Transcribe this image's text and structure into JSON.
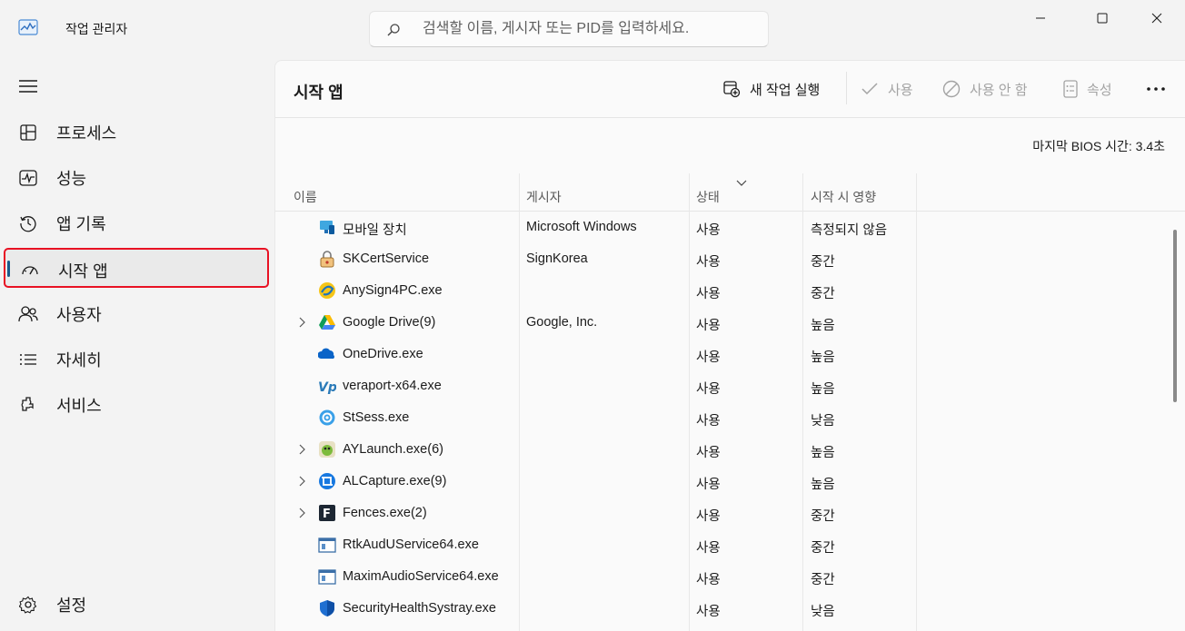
{
  "window": {
    "title": "작업 관리자",
    "search_placeholder": "검색할 이름, 게시자 또는 PID를 입력하세요."
  },
  "sidebar": {
    "items": [
      {
        "label": "프로세스",
        "icon": "processes-icon"
      },
      {
        "label": "성능",
        "icon": "performance-icon"
      },
      {
        "label": "앱 기록",
        "icon": "app-history-icon"
      },
      {
        "label": "시작 앱",
        "icon": "startup-apps-icon",
        "active": true
      },
      {
        "label": "사용자",
        "icon": "users-icon"
      },
      {
        "label": "자세히",
        "icon": "details-icon"
      },
      {
        "label": "서비스",
        "icon": "services-icon"
      }
    ],
    "settings_label": "설정"
  },
  "page": {
    "title": "시작 앱",
    "toolbar": {
      "new_task": "새 작업 실행",
      "enable": "사용",
      "disable": "사용 안 함",
      "properties": "속성"
    },
    "bios_label": "마지막 BIOS 시간:",
    "bios_value": "3.4초"
  },
  "table": {
    "columns": [
      "이름",
      "게시자",
      "상태",
      "시작 시 영향"
    ],
    "rows": [
      {
        "name": "모바일 장치",
        "publisher": "Microsoft Windows",
        "status": "사용",
        "impact": "측정되지 않음",
        "expandable": false,
        "icon": "mobile-devices-icon"
      },
      {
        "name": "SKCertService",
        "publisher": "SignKorea",
        "status": "사용",
        "impact": "중간",
        "expandable": false,
        "icon": "lock-icon"
      },
      {
        "name": "AnySign4PC.exe",
        "publisher": "",
        "status": "사용",
        "impact": "중간",
        "expandable": false,
        "icon": "anysign-icon"
      },
      {
        "name": "Google Drive(9)",
        "publisher": "Google, Inc.",
        "status": "사용",
        "impact": "높음",
        "expandable": true,
        "icon": "google-drive-icon"
      },
      {
        "name": "OneDrive.exe",
        "publisher": "",
        "status": "사용",
        "impact": "높음",
        "expandable": false,
        "icon": "onedrive-icon"
      },
      {
        "name": "veraport-x64.exe",
        "publisher": "",
        "status": "사용",
        "impact": "높음",
        "expandable": false,
        "icon": "veraport-icon"
      },
      {
        "name": "StSess.exe",
        "publisher": "",
        "status": "사용",
        "impact": "낮음",
        "expandable": false,
        "icon": "gear-icon"
      },
      {
        "name": "AYLaunch.exe(6)",
        "publisher": "",
        "status": "사용",
        "impact": "높음",
        "expandable": true,
        "icon": "aylaunch-icon"
      },
      {
        "name": "ALCapture.exe(9)",
        "publisher": "",
        "status": "사용",
        "impact": "높음",
        "expandable": true,
        "icon": "alcapture-icon"
      },
      {
        "name": "Fences.exe(2)",
        "publisher": "",
        "status": "사용",
        "impact": "중간",
        "expandable": true,
        "icon": "fences-icon"
      },
      {
        "name": "RtkAudUService64.exe",
        "publisher": "",
        "status": "사용",
        "impact": "중간",
        "expandable": false,
        "icon": "app-window-icon"
      },
      {
        "name": "MaximAudioService64.exe",
        "publisher": "",
        "status": "사용",
        "impact": "중간",
        "expandable": false,
        "icon": "app-window-icon"
      },
      {
        "name": "SecurityHealthSystray.exe",
        "publisher": "",
        "status": "사용",
        "impact": "낮음",
        "expandable": false,
        "icon": "shield-icon"
      }
    ]
  }
}
